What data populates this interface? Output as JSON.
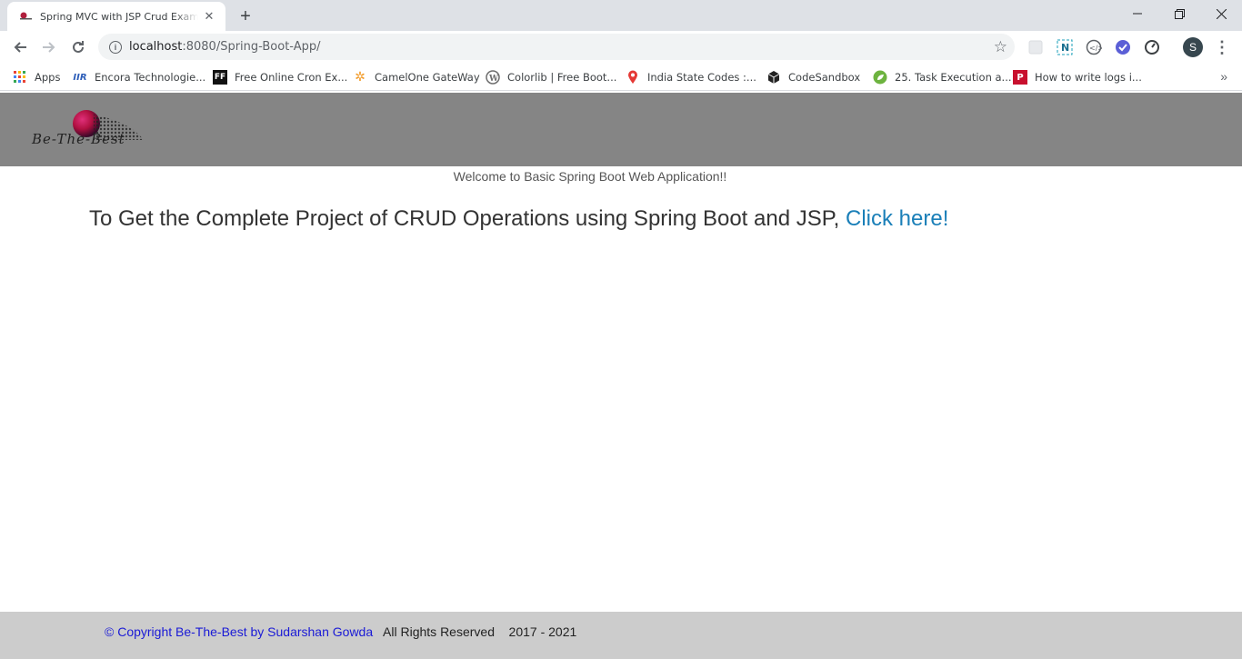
{
  "browser": {
    "tab": {
      "title": "Spring MVC with JSP Crud Example",
      "favicon": "red-sphere-logo-icon"
    },
    "url": {
      "host": "localhost",
      "rest": ":8080/Spring-Boot-App/"
    },
    "profile_initial": "S",
    "bookmarks": [
      {
        "label": "Apps",
        "icon": "apps-grid-icon"
      },
      {
        "label": "Encora Technologie...",
        "icon": "encora-icon"
      },
      {
        "label": "Free Online Cron Ex...",
        "icon": "ff-icon"
      },
      {
        "label": "CamelOne GateWay",
        "icon": "camel-icon"
      },
      {
        "label": "Colorlib | Free Boot...",
        "icon": "wordpress-icon"
      },
      {
        "label": "India State Codes :...",
        "icon": "map-pin-icon"
      },
      {
        "label": "CodeSandbox",
        "icon": "codesandbox-icon"
      },
      {
        "label": "25. Task Execution a...",
        "icon": "spring-leaf-icon"
      },
      {
        "label": "How to write logs i...",
        "icon": "p-icon"
      }
    ]
  },
  "page": {
    "logo_text": "Be-The-Best",
    "welcome": "Welcome to Basic Spring Boot Web Application!!",
    "headline": "To Get the Complete Project of CRUD Operations using Spring Boot and JSP,",
    "link_text": "Click here!",
    "footer": {
      "copyright": "© Copyright Be-The-Best by Sudarshan Gowda",
      "rights": "All Rights Reserved",
      "years": "2017 - 2021"
    }
  },
  "colors": {
    "header_bg": "#858585",
    "footer_bg": "#cccccc",
    "link": "#1a7fb8",
    "copyright": "#1a1ad6"
  }
}
